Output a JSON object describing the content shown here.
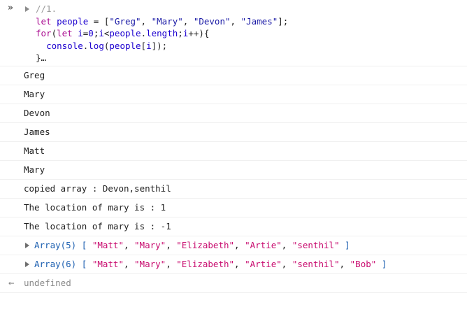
{
  "input": {
    "prompt_glyph": "»",
    "lines": [
      "//1.",
      "let people = [\"Greg\", \"Mary\", \"Devon\", \"James\"];",
      "for(let i=0;i<people.length;i++){",
      "  console.log(people[i]);",
      "}…"
    ]
  },
  "logs": [
    "Greg",
    "Mary",
    "Devon",
    "James",
    "Matt",
    "Mary",
    "copied array : Devon,senthil",
    "The location of mary is : 1",
    "The location of mary is : -1"
  ],
  "arrays": [
    {
      "label": "Array(5)",
      "items": [
        "\"Matt\"",
        "\"Mary\"",
        "\"Elizabeth\"",
        "\"Artie\"",
        "\"senthil\""
      ]
    },
    {
      "label": "Array(6)",
      "items": [
        "\"Matt\"",
        "\"Mary\"",
        "\"Elizabeth\"",
        "\"Artie\"",
        "\"senthil\"",
        "\"Bob\""
      ]
    }
  ],
  "result": {
    "arrow": "←",
    "text": "undefined"
  }
}
